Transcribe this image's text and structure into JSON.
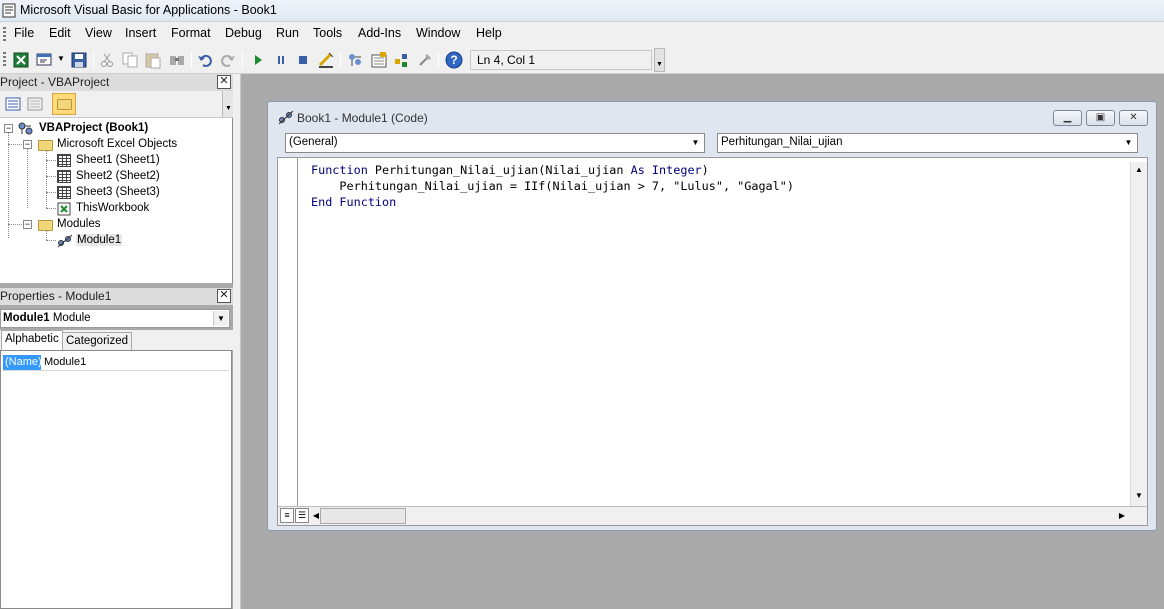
{
  "window": {
    "title": "Microsoft Visual Basic for Applications - Book1"
  },
  "menu": {
    "items": [
      "File",
      "Edit",
      "View",
      "Insert",
      "Format",
      "Debug",
      "Run",
      "Tools",
      "Add-Ins",
      "Window",
      "Help"
    ]
  },
  "toolbar": {
    "icons": [
      "excel-icon",
      "insert-module-icon",
      "save-icon",
      "cut-icon",
      "copy-icon",
      "paste-icon",
      "find-icon",
      "undo-icon",
      "redo-icon",
      "run-icon",
      "break-icon",
      "reset-icon",
      "design-mode-icon",
      "project-explorer-icon",
      "properties-icon",
      "object-browser-icon",
      "toolbox-icon",
      "help-icon"
    ],
    "cursor_position": "Ln 4, Col 1"
  },
  "project_pane": {
    "title": "Project - VBAProject",
    "root": "VBAProject (Book1)",
    "excel_objects_folder": "Microsoft Excel Objects",
    "sheets": [
      "Sheet1 (Sheet1)",
      "Sheet2 (Sheet2)",
      "Sheet3 (Sheet3)"
    ],
    "workbook": "ThisWorkbook",
    "modules_folder": "Modules",
    "module": "Module1"
  },
  "properties_pane": {
    "title": "Properties - Module1",
    "object_name": "Module1",
    "object_type": "Module",
    "tabs": [
      "Alphabetic",
      "Categorized"
    ],
    "rows": [
      {
        "name": "(Name)",
        "value": "Module1"
      }
    ]
  },
  "code_window": {
    "title": "Book1 - Module1 (Code)",
    "object_combo": "(General)",
    "procedure_combo": "Perhitungan_Nilai_ujian",
    "lines": [
      {
        "kw1": "Function",
        "text": " Perhitungan_Nilai_ujian(Nilai_ujian ",
        "kw2": "As Integer",
        "rest": ")"
      },
      {
        "indent": "    ",
        "text": "Perhitungan_Nilai_ujian = IIf(Nilai_ujian > 7, \"Lulus\", \"Gagal\")"
      },
      {
        "kw1": "End Function"
      }
    ]
  },
  "colors": {
    "keyword": "#00007f",
    "selection": "#3399ff",
    "mdi_background": "#a9a9a9"
  }
}
